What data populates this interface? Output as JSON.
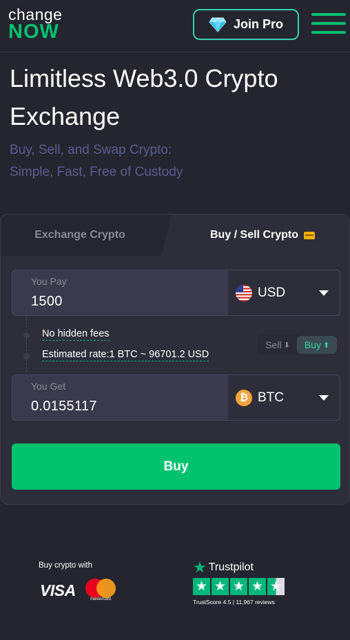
{
  "header": {
    "logo_top": "change",
    "logo_bottom": "NOW",
    "join_pro_label": "Join Pro",
    "icons": {
      "join_pro": "diamond-icon",
      "menu": "hamburger-menu-icon"
    }
  },
  "hero": {
    "title": "Limitless Web3.0 Crypto Exchange",
    "subtitle_line1": "Buy, Sell, and Swap Crypto:",
    "subtitle_line2": "Simple, Fast, Free of Custody"
  },
  "widget": {
    "tabs": [
      {
        "label": "Exchange Crypto",
        "active": false
      },
      {
        "label": "Buy / Sell Crypto",
        "active": true,
        "icon": "wallet-icon"
      }
    ],
    "pay": {
      "label": "You Pay",
      "value": "1500",
      "currency": "USD",
      "currency_icon": "us-flag-icon"
    },
    "info": {
      "no_fees": "No hidden fees",
      "estimated_rate": "Estimated rate:1 BTC ~ 96701.2 USD"
    },
    "toggle": {
      "sell_label": "Sell",
      "sell_arrow": "⬇",
      "buy_label": "Buy",
      "buy_arrow": "⬆",
      "selected": "Buy"
    },
    "get": {
      "label": "You Get",
      "value": "0.0155117",
      "currency": "BTC",
      "currency_icon": "bitcoin-icon",
      "currency_symbol": "₿"
    },
    "buy_button_label": "Buy"
  },
  "footer": {
    "buy_with_text": "Buy crypto with",
    "visa": "VISA",
    "mastercard": "mastercard",
    "trustpilot": {
      "name": "Trustpilot",
      "rating_stars": 4.5,
      "score_text": "TrustScore 4.5 | 11,967 reviews"
    }
  },
  "colors": {
    "background": "#25252f",
    "brand_green": "#00c26f",
    "accent_teal": "#39d0b0",
    "subtitle_purple": "#5c5b93",
    "trustpilot_green": "#00b67a"
  }
}
